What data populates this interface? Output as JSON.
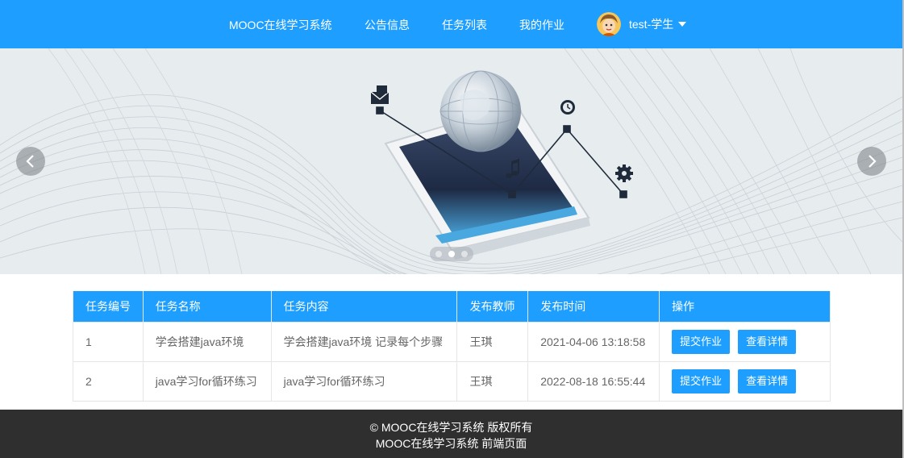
{
  "nav": {
    "brand": "MOOC在线学习系统",
    "items": [
      "公告信息",
      "任务列表",
      "我的作业"
    ],
    "user": "test-学生"
  },
  "carousel": {
    "slide_count": 3,
    "active_index": 1
  },
  "table": {
    "headers": [
      "任务编号",
      "任务名称",
      "任务内容",
      "发布教师",
      "发布时间",
      "操作"
    ],
    "rows": [
      {
        "id": "1",
        "name": "学会搭建java环境",
        "content": "学会搭建java环境 记录每个步骤",
        "teacher": "王琪",
        "time": "2021-04-06 13:18:58",
        "submit": "提交作业",
        "detail": "查看详情"
      },
      {
        "id": "2",
        "name": "java学习for循环练习",
        "content": "java学习for循环练习",
        "teacher": "王琪",
        "time": "2022-08-18 16:55:44",
        "submit": "提交作业",
        "detail": "查看详情"
      }
    ]
  },
  "footer": {
    "line1": "© MOOC在线学习系统 版权所有",
    "line2": "MOOC在线学习系统 前端页面"
  },
  "colors": {
    "primary": "#1e9fff",
    "footer_bg": "#2f2f2f"
  },
  "icons": [
    "avatar-image",
    "caret-down-icon",
    "chevron-left-icon",
    "chevron-right-icon",
    "mail-icon",
    "clock-icon",
    "music-note-icon",
    "gear-icon",
    "globe-image",
    "tablet-image"
  ]
}
